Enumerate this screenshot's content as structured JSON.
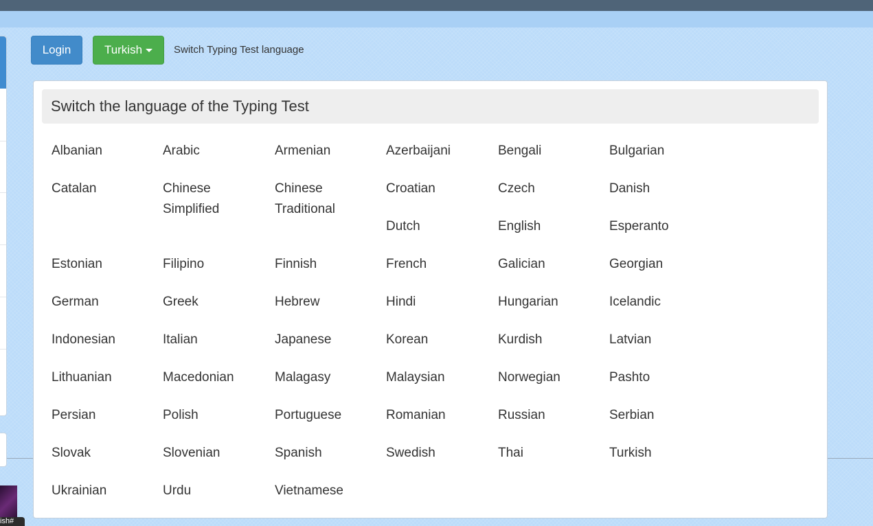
{
  "header": {
    "login_label": "Login",
    "language_button_label": "Turkish",
    "language_hint": "Switch Typing Test language"
  },
  "side": {
    "tooltip_text": "ish#"
  },
  "panel": {
    "title": "Switch the language of the Typing Test",
    "languages": [
      "Albanian",
      "Arabic",
      "Armenian",
      "Azerbaijani",
      "Bengali",
      "Bulgarian",
      "Catalan",
      "Chinese Simplified",
      "Chinese Traditional",
      "Croatian",
      "Czech",
      "Danish",
      "Dutch",
      "English",
      "Esperanto",
      "Estonian",
      "Filipino",
      "Finnish",
      "French",
      "Galician",
      "Georgian",
      "German",
      "Greek",
      "Hebrew",
      "Hindi",
      "Hungarian",
      "Icelandic",
      "Indonesian",
      "Italian",
      "Japanese",
      "Korean",
      "Kurdish",
      "Latvian",
      "Lithuanian",
      "Macedonian",
      "Malagasy",
      "Malaysian",
      "Norwegian",
      "Pashto",
      "Persian",
      "Polish",
      "Portuguese",
      "Romanian",
      "Russian",
      "Serbian",
      "Slovak",
      "Slovenian",
      "Spanish",
      "Swedish",
      "Thai",
      "Turkish",
      "Ukrainian",
      "Urdu",
      "Vietnamese"
    ]
  },
  "colors": {
    "page_background": "#bcdcfa",
    "login_button": "#428bca",
    "language_button": "#4cae4c",
    "top_bar": "#4f6478"
  }
}
